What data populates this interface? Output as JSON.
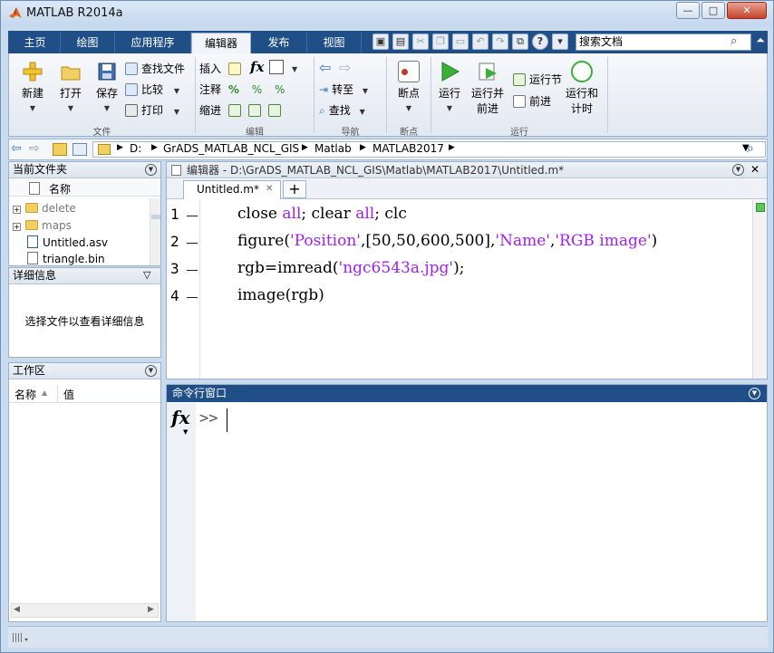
{
  "window": {
    "title": "MATLAB R2014a"
  },
  "ribbon_tabs": [
    "主页",
    "绘图",
    "应用程序",
    "编辑器",
    "发布",
    "视图"
  ],
  "active_tab": "编辑器",
  "search": {
    "placeholder": "搜索文档"
  },
  "ribbon": {
    "file": {
      "label": "文件",
      "new": "新建",
      "open": "打开",
      "save": "保存",
      "find_files": "查找文件",
      "compare": "比较",
      "print": "打印"
    },
    "edit": {
      "label": "编辑",
      "insert": "插入",
      "comment": "注释",
      "indent": "缩进",
      "fx": "fx"
    },
    "navigate": {
      "label": "导航",
      "goto": "转至",
      "find": "查找"
    },
    "breakpoints": {
      "label": "断点",
      "breakpoints": "断点"
    },
    "run": {
      "label": "运行",
      "run": "运行",
      "run_advance_1": "运行并",
      "run_advance_2": "前进",
      "run_section": "运行节",
      "advance": "前进",
      "run_time_1": "运行和",
      "run_time_2": "计时"
    }
  },
  "address": {
    "crumbs": [
      "D:",
      "GrADS_MATLAB_NCL_GIS",
      "Matlab",
      "MATLAB2017"
    ]
  },
  "current_folder": {
    "title": "当前文件夹",
    "col_name": "名称",
    "items": [
      {
        "name": "delete",
        "type": "folder"
      },
      {
        "name": "maps",
        "type": "folder"
      },
      {
        "name": "Untitled.asv",
        "type": "file"
      },
      {
        "name": "triangle.bin",
        "type": "file"
      }
    ]
  },
  "details": {
    "title": "详细信息",
    "message": "选择文件以查看详细信息"
  },
  "workspace": {
    "title": "工作区",
    "col_name": "名称",
    "col_value": "值"
  },
  "editor": {
    "title": "编辑器 - D:\\GrADS_MATLAB_NCL_GIS\\Matlab\\MATLAB2017\\Untitled.m*",
    "tab": "Untitled.m*",
    "lines": [
      {
        "num": "1",
        "parts": [
          [
            "close ",
            "n"
          ],
          [
            "all",
            "k"
          ],
          [
            "; clear ",
            "n"
          ],
          [
            "all",
            "k"
          ],
          [
            "; clc",
            "n"
          ]
        ]
      },
      {
        "num": "2",
        "parts": [
          [
            "figure(",
            "n"
          ],
          [
            "'Position'",
            "k"
          ],
          [
            ",[50,50,600,500],",
            "n"
          ],
          [
            "'Name'",
            "k"
          ],
          [
            ",",
            "n"
          ],
          [
            "'RGB image'",
            "k"
          ],
          [
            ")",
            "n"
          ]
        ]
      },
      {
        "num": "3",
        "parts": [
          [
            "rgb=imread(",
            "n"
          ],
          [
            "'ngc6543a.jpg'",
            "k"
          ],
          [
            ");",
            "n"
          ]
        ]
      },
      {
        "num": "4",
        "parts": [
          [
            "image(rgb)",
            "n"
          ]
        ]
      }
    ]
  },
  "command_window": {
    "title": "命令行窗口",
    "prompt": ">>",
    "fx": "fx"
  },
  "colors": {
    "tab_bar": "#1f4f86",
    "command_header": "#1f4f86",
    "string": "#a020f0",
    "keyword": "#a020f0"
  }
}
